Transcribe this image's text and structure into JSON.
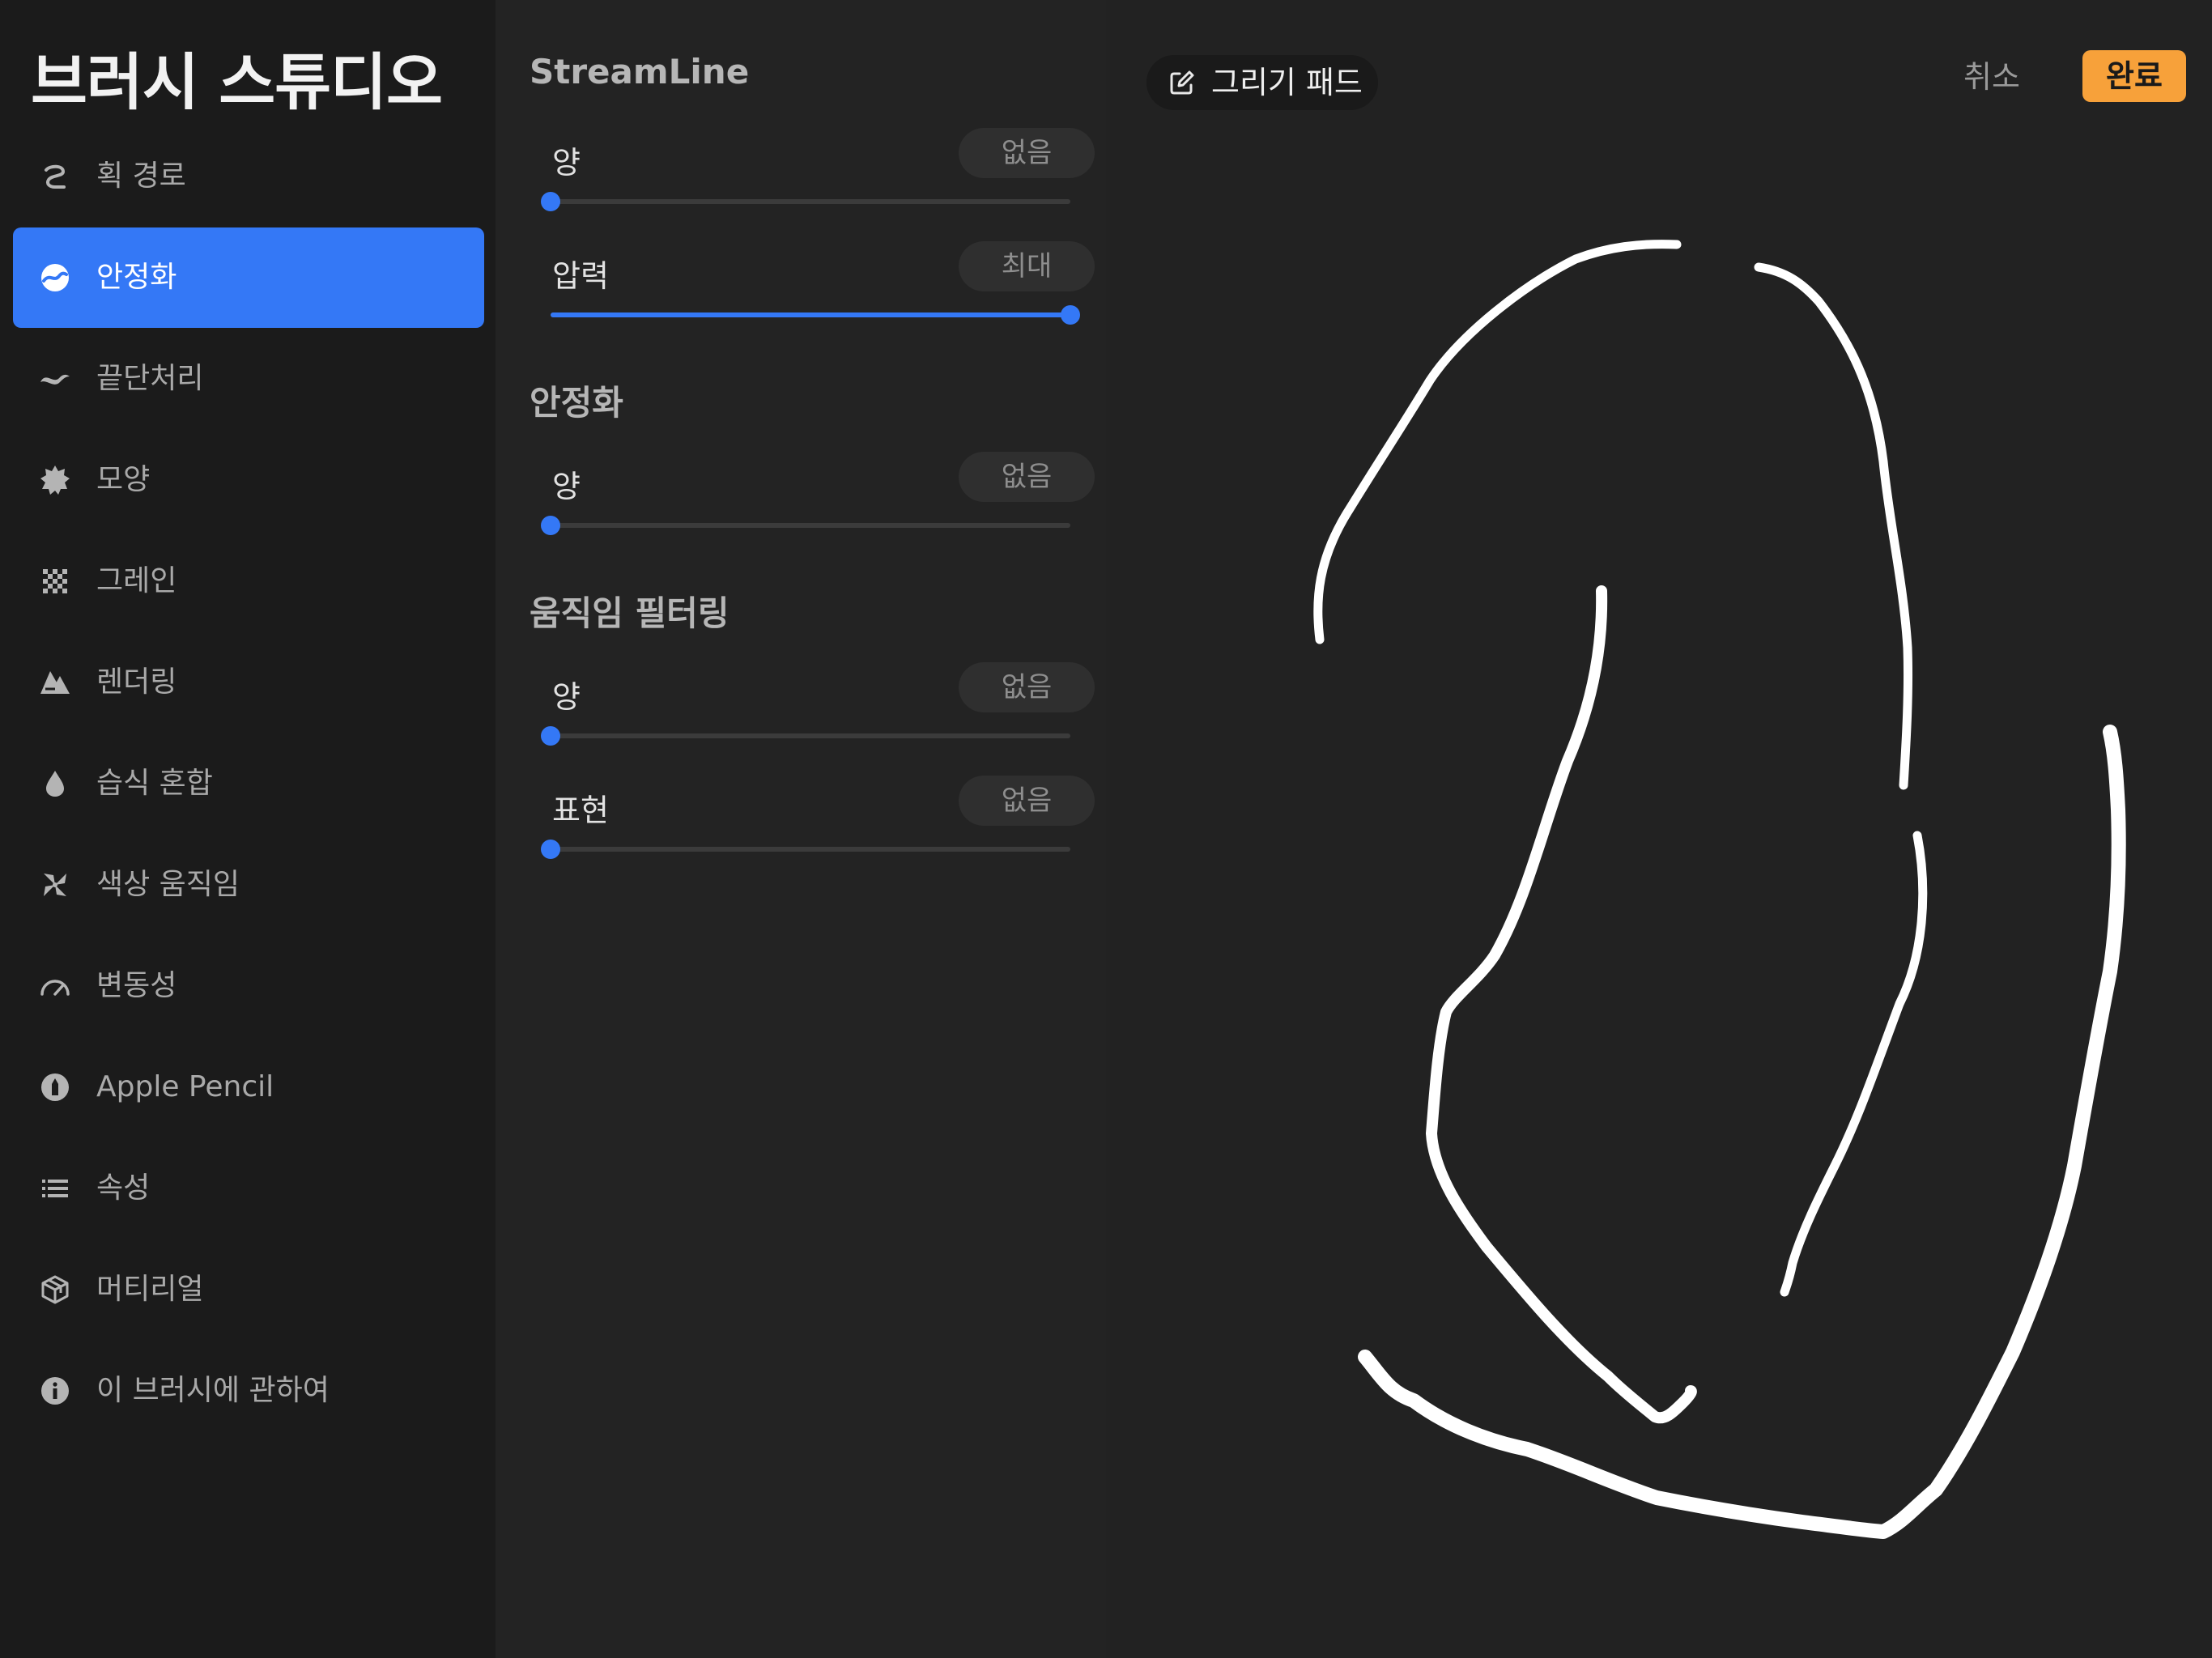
{
  "sidebar": {
    "title": "브러시 스튜디오",
    "items": [
      {
        "label": "획 경로",
        "icon": "stroke-path-icon",
        "active": false
      },
      {
        "label": "안정화",
        "icon": "stabilization-icon",
        "active": true
      },
      {
        "label": "끝단처리",
        "icon": "taper-icon",
        "active": false
      },
      {
        "label": "모양",
        "icon": "shape-icon",
        "active": false
      },
      {
        "label": "그레인",
        "icon": "grain-icon",
        "active": false
      },
      {
        "label": "렌더링",
        "icon": "rendering-icon",
        "active": false
      },
      {
        "label": "습식 혼합",
        "icon": "wet-mix-icon",
        "active": false
      },
      {
        "label": "색상 움직임",
        "icon": "color-dynamics-icon",
        "active": false
      },
      {
        "label": "변동성",
        "icon": "dynamics-icon",
        "active": false
      },
      {
        "label": "Apple Pencil",
        "icon": "apple-pencil-icon",
        "active": false
      },
      {
        "label": "속성",
        "icon": "properties-icon",
        "active": false
      },
      {
        "label": "머티리얼",
        "icon": "materials-icon",
        "active": false
      },
      {
        "label": "이 브러시에 관하여",
        "icon": "info-icon",
        "active": false
      }
    ]
  },
  "settings": {
    "streamline": {
      "title": "StreamLine",
      "amount": {
        "label": "양",
        "value_text": "없음",
        "level": 0
      },
      "pressure": {
        "label": "압력",
        "value_text": "최대",
        "level": 1
      }
    },
    "stabilization": {
      "title": "안정화",
      "amount": {
        "label": "양",
        "value_text": "없음",
        "level": 0
      }
    },
    "motion_filtering": {
      "title": "움직임 필터링",
      "amount": {
        "label": "양",
        "value_text": "없음",
        "level": 0
      },
      "expression": {
        "label": "표현",
        "value_text": "없음",
        "level": 0
      }
    }
  },
  "pad": {
    "title": "그리기 패드",
    "icon": "edit-icon",
    "cancel_label": "취소",
    "done_label": "완료"
  },
  "colors": {
    "accent": "#3478f6",
    "done": "#f7a13a",
    "stroke": "#ffffff"
  }
}
